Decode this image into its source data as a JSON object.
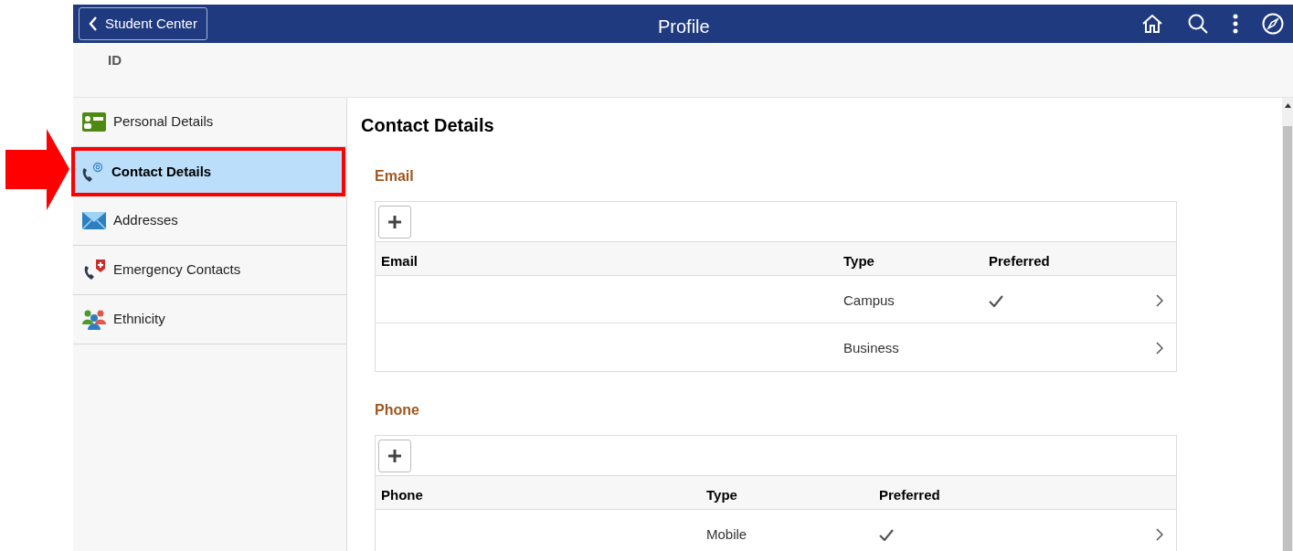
{
  "header": {
    "back_button": "Student Center",
    "title": "Profile",
    "id_label": "ID"
  },
  "sidebar": {
    "items": [
      {
        "label": "Personal Details",
        "selected": false
      },
      {
        "label": "Contact Details",
        "selected": true
      },
      {
        "label": "Addresses",
        "selected": false
      },
      {
        "label": "Emergency Contacts",
        "selected": false
      },
      {
        "label": "Ethnicity",
        "selected": false
      }
    ]
  },
  "content": {
    "title": "Contact Details",
    "sections": [
      {
        "title": "Email",
        "columns": [
          "Email",
          "Type",
          "Preferred"
        ],
        "rows": [
          {
            "type": "Campus",
            "preferred": true
          },
          {
            "type": "Business",
            "preferred": false
          }
        ]
      },
      {
        "title": "Phone",
        "columns": [
          "Phone",
          "Type",
          "Preferred"
        ],
        "rows": [
          {
            "type": "Mobile",
            "preferred": true
          }
        ]
      }
    ]
  }
}
